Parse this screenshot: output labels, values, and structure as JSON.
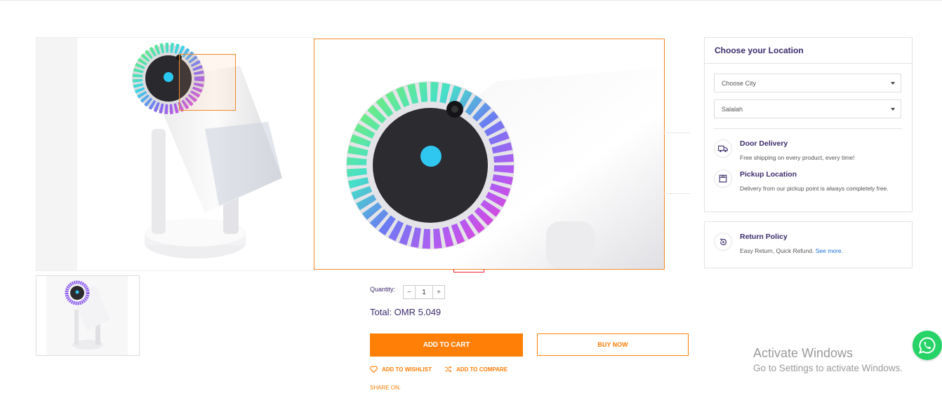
{
  "product": {
    "quantity_label": "Quantity:",
    "quantity_minus": "−",
    "quantity_value": "1",
    "quantity_plus": "+",
    "total": "Total: OMR 5.049",
    "add_to_cart": "ADD TO CART",
    "buy_now": "BUY NOW",
    "add_to_wishlist": "ADD TO WISHLIST",
    "add_to_compare": "ADD TO COMPARE",
    "share_on": "SHARE ON:"
  },
  "location": {
    "title": "Choose your Location",
    "city_select": "Choose City",
    "area_select": "Salalah",
    "door_delivery_title": "Door Delivery",
    "door_delivery_desc": "Free shipping on every product, every time!",
    "pickup_title": "Pickup Location",
    "pickup_desc": "Delivery from our pickup point is always completely free."
  },
  "return_policy": {
    "title": "Return Policy",
    "desc": "Easy Return, Quick Refund. ",
    "see_more": "See more."
  },
  "os_watermark": {
    "line1": "Activate Windows",
    "line2": "Go to Settings to activate Windows."
  },
  "icons": [
    "truck-icon",
    "box-icon",
    "return-icon",
    "heart-icon",
    "shuffle-icon",
    "whatsapp-icon"
  ],
  "colors": {
    "accent": "#ff7f07",
    "heading": "#3b2a6b",
    "link": "#1a6fd8",
    "whatsapp": "#25d366"
  }
}
